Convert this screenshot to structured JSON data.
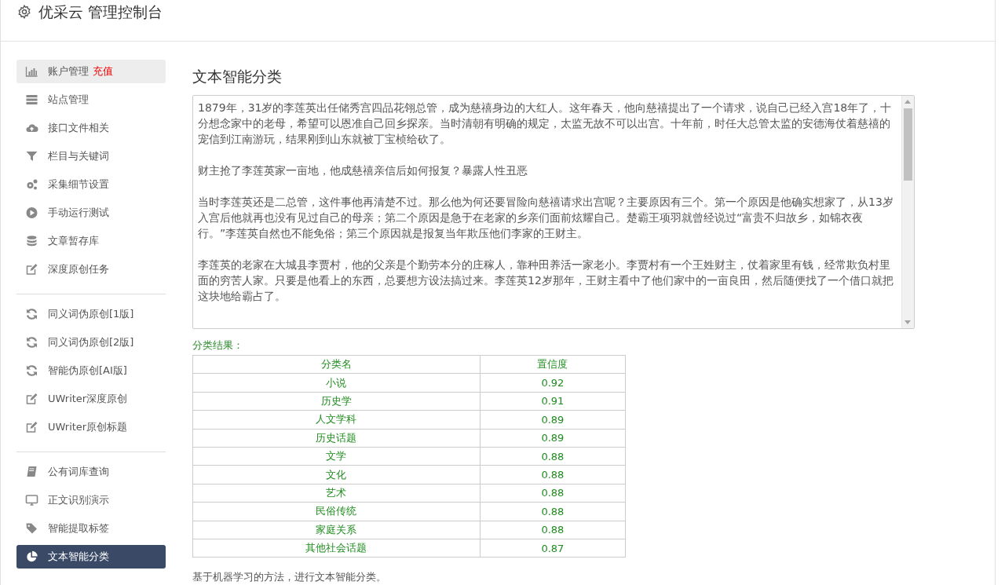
{
  "header": {
    "title": "优采云 管理控制台"
  },
  "sidebar": {
    "groups": [
      {
        "items": [
          {
            "label": "账户管理",
            "badge": "充值",
            "highlighted": true,
            "selected": false
          },
          {
            "label": "站点管理",
            "highlighted": false,
            "selected": false
          },
          {
            "label": "接口文件相关",
            "highlighted": false,
            "selected": false
          },
          {
            "label": "栏目与关键词",
            "highlighted": false,
            "selected": false
          },
          {
            "label": "采集细节设置",
            "highlighted": false,
            "selected": false
          },
          {
            "label": "手动运行测试",
            "highlighted": false,
            "selected": false
          },
          {
            "label": "文章暂存库",
            "highlighted": false,
            "selected": false
          },
          {
            "label": "深度原创任务",
            "highlighted": false,
            "selected": false
          }
        ]
      },
      {
        "items": [
          {
            "label": "同义词伪原创[1版]",
            "highlighted": false,
            "selected": false
          },
          {
            "label": "同义词伪原创[2版]",
            "highlighted": false,
            "selected": false
          },
          {
            "label": "智能伪原创[AI版]",
            "highlighted": false,
            "selected": false
          },
          {
            "label": "UWriter深度原创",
            "highlighted": false,
            "selected": false
          },
          {
            "label": "UWriter原创标题",
            "highlighted": false,
            "selected": false
          }
        ]
      },
      {
        "items": [
          {
            "label": "公有词库查询",
            "highlighted": false,
            "selected": false
          },
          {
            "label": "正文识别演示",
            "highlighted": false,
            "selected": false
          },
          {
            "label": "智能提取标签",
            "highlighted": false,
            "selected": false
          },
          {
            "label": "文本智能分类",
            "highlighted": false,
            "selected": true
          }
        ]
      }
    ]
  },
  "main": {
    "title": "文本智能分类",
    "article": [
      "1879年，31岁的李莲英出任储秀宫四品花翎总管，成为慈禧身边的大红人。这年春天，他向慈禧提出了一个请求，说自己已经入宫18年了，十分想念家中的老母，希望可以恩准自己回乡探亲。当时清朝有明确的规定，太监无故不可以出宫。十年前，时任大总管太监的安德海仗着慈禧的宠信到江南游玩，结果刚到山东就被丁宝桢给砍了。",
      "财主抢了李莲英家一亩地，他成慈禧亲信后如何报复？暴露人性丑恶",
      "当时李莲英还是二总管，这件事他再清楚不过。那么他为何还要冒险向慈禧请求出宫呢？主要原因有三个。第一个原因是他确实想家了，从13岁入宫后他就再也没有见过自己的母亲；第二个原因是急于在老家的乡亲们面前炫耀自己。楚霸王项羽就曾经说过“富贵不归故乡，如锦衣夜行。”李莲英自然也不能免俗；第三个原因就是报复当年欺压他们李家的王财主。",
      "李莲英的老家在大城县李贾村，他的父亲是个勤劳本分的庄稼人，靠种田养活一家老小。李贾村有一个王姓财主，仗着家里有钱，经常欺负村里面的穷苦人家。只要是他看上的东西，总要想方设法搞过来。李莲英12岁那年，王财主看中了他们家中的一亩良田，然后随便找了一个借口就把这块地给霸占了。"
    ],
    "result_label": "分类结果：",
    "table": {
      "columns": [
        "分类名",
        "置信度"
      ],
      "rows": [
        [
          "小说",
          "0.92"
        ],
        [
          "历史学",
          "0.91"
        ],
        [
          "人文学科",
          "0.89"
        ],
        [
          "历史话题",
          "0.89"
        ],
        [
          "文学",
          "0.88"
        ],
        [
          "文化",
          "0.88"
        ],
        [
          "艺术",
          "0.88"
        ],
        [
          "民俗传统",
          "0.88"
        ],
        [
          "家庭关系",
          "0.88"
        ],
        [
          "其他社会话题",
          "0.87"
        ]
      ]
    },
    "description": "基于机器学习的方法，进行文本智能分类。"
  }
}
